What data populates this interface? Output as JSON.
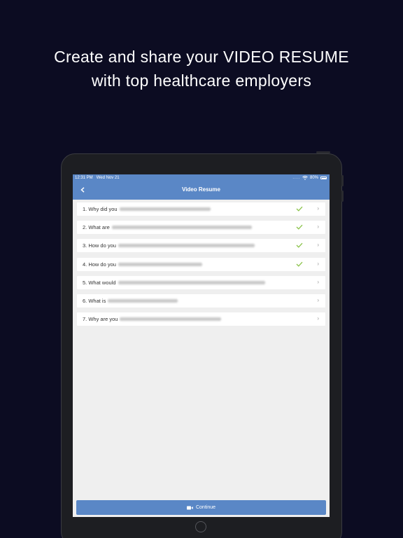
{
  "headline": {
    "line1": "Create and share your VIDEO RESUME",
    "line2": "with top healthcare employers"
  },
  "status_bar": {
    "time": "12:31 PM",
    "date": "Wed Nov 21",
    "battery": "80%"
  },
  "nav": {
    "title": "Video Resume",
    "back_icon": "chevron-left-icon"
  },
  "questions": [
    {
      "label": "1. Why did you",
      "completed": true
    },
    {
      "label": "2. What are",
      "completed": true
    },
    {
      "label": "3. How do you",
      "completed": true
    },
    {
      "label": "4. How do you",
      "completed": true
    },
    {
      "label": "5. What would",
      "completed": false
    },
    {
      "label": "6. What is",
      "completed": false
    },
    {
      "label": "7. Why are you",
      "completed": false
    }
  ],
  "continue_button": {
    "label": "Continue",
    "icon": "video-camera-icon"
  },
  "colors": {
    "accent": "#5a87c6",
    "check": "#8bc34a",
    "background": "#0c0c22"
  }
}
